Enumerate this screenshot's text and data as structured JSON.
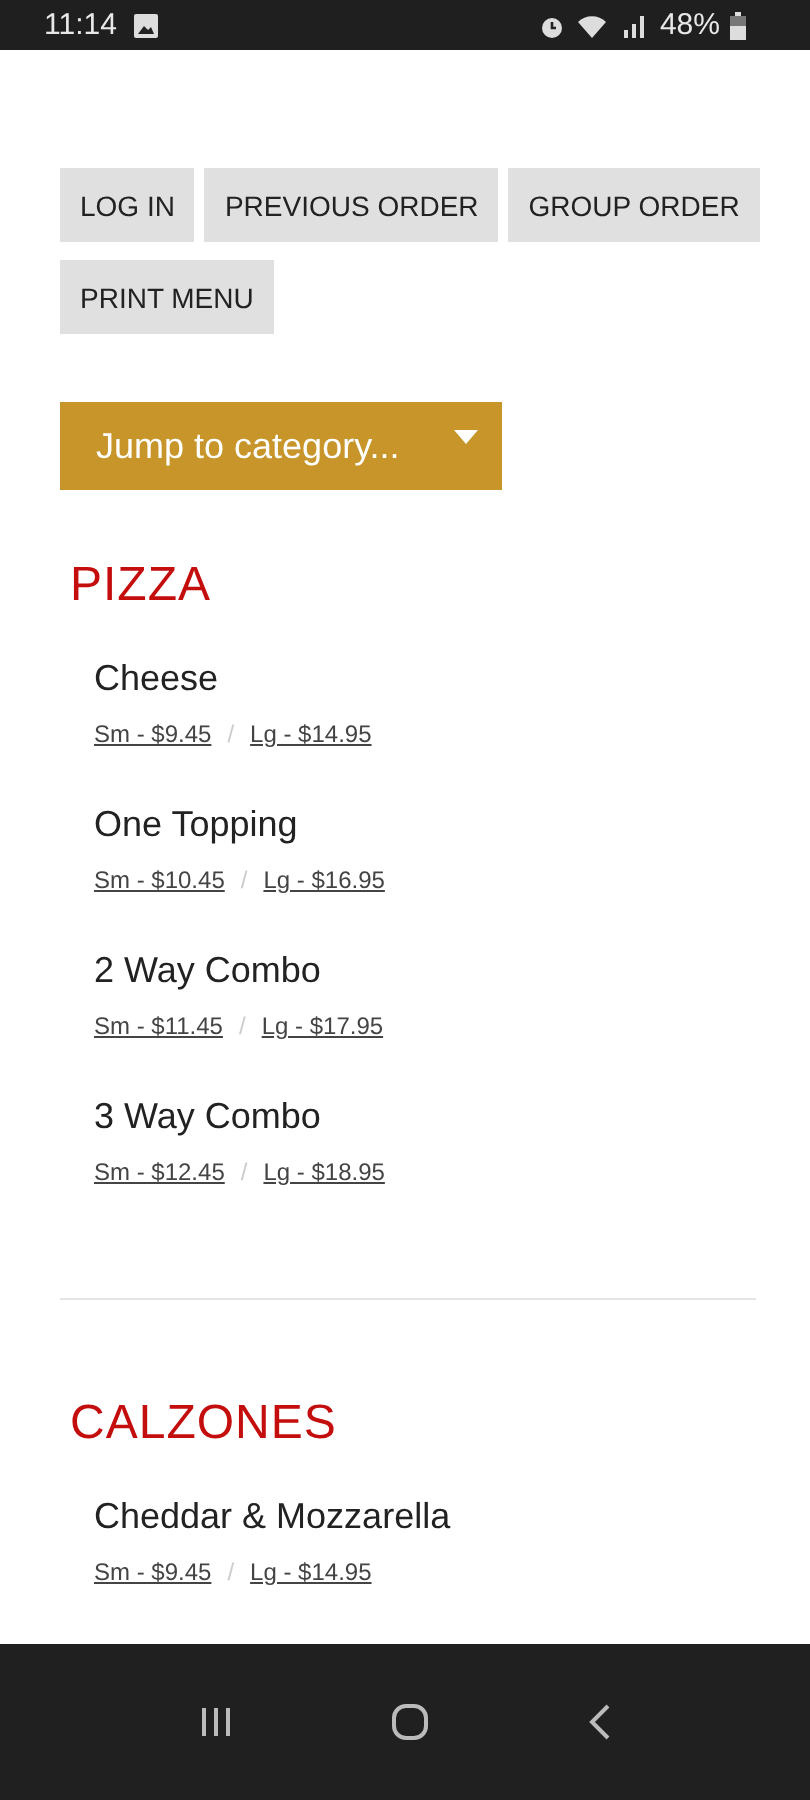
{
  "status_bar": {
    "time": "11:14",
    "battery": "48%"
  },
  "buttons": [
    "LOG IN",
    "PREVIOUS ORDER",
    "GROUP ORDER",
    "PRINT MENU"
  ],
  "category_select": {
    "value": "Jump to category..."
  },
  "sections": [
    {
      "title": "PIZZA",
      "items": [
        {
          "name": "Cheese",
          "prices": [
            "Sm - $9.45",
            "Lg - $14.95"
          ],
          "separator": "/"
        },
        {
          "name": "One Topping",
          "prices": [
            "Sm - $10.45",
            "Lg - $16.95"
          ],
          "separator": "/"
        },
        {
          "name": "2 Way Combo",
          "prices": [
            "Sm - $11.45",
            "Lg - $17.95"
          ],
          "separator": "/"
        },
        {
          "name": "3 Way Combo",
          "prices": [
            "Sm - $12.45",
            "Lg - $18.95"
          ],
          "separator": "/"
        }
      ]
    },
    {
      "title": "CALZONES",
      "items": [
        {
          "name": "Cheddar & Mozzarella",
          "prices": [
            "Sm - $9.45",
            "Lg - $14.95"
          ],
          "separator": "/"
        }
      ]
    }
  ]
}
